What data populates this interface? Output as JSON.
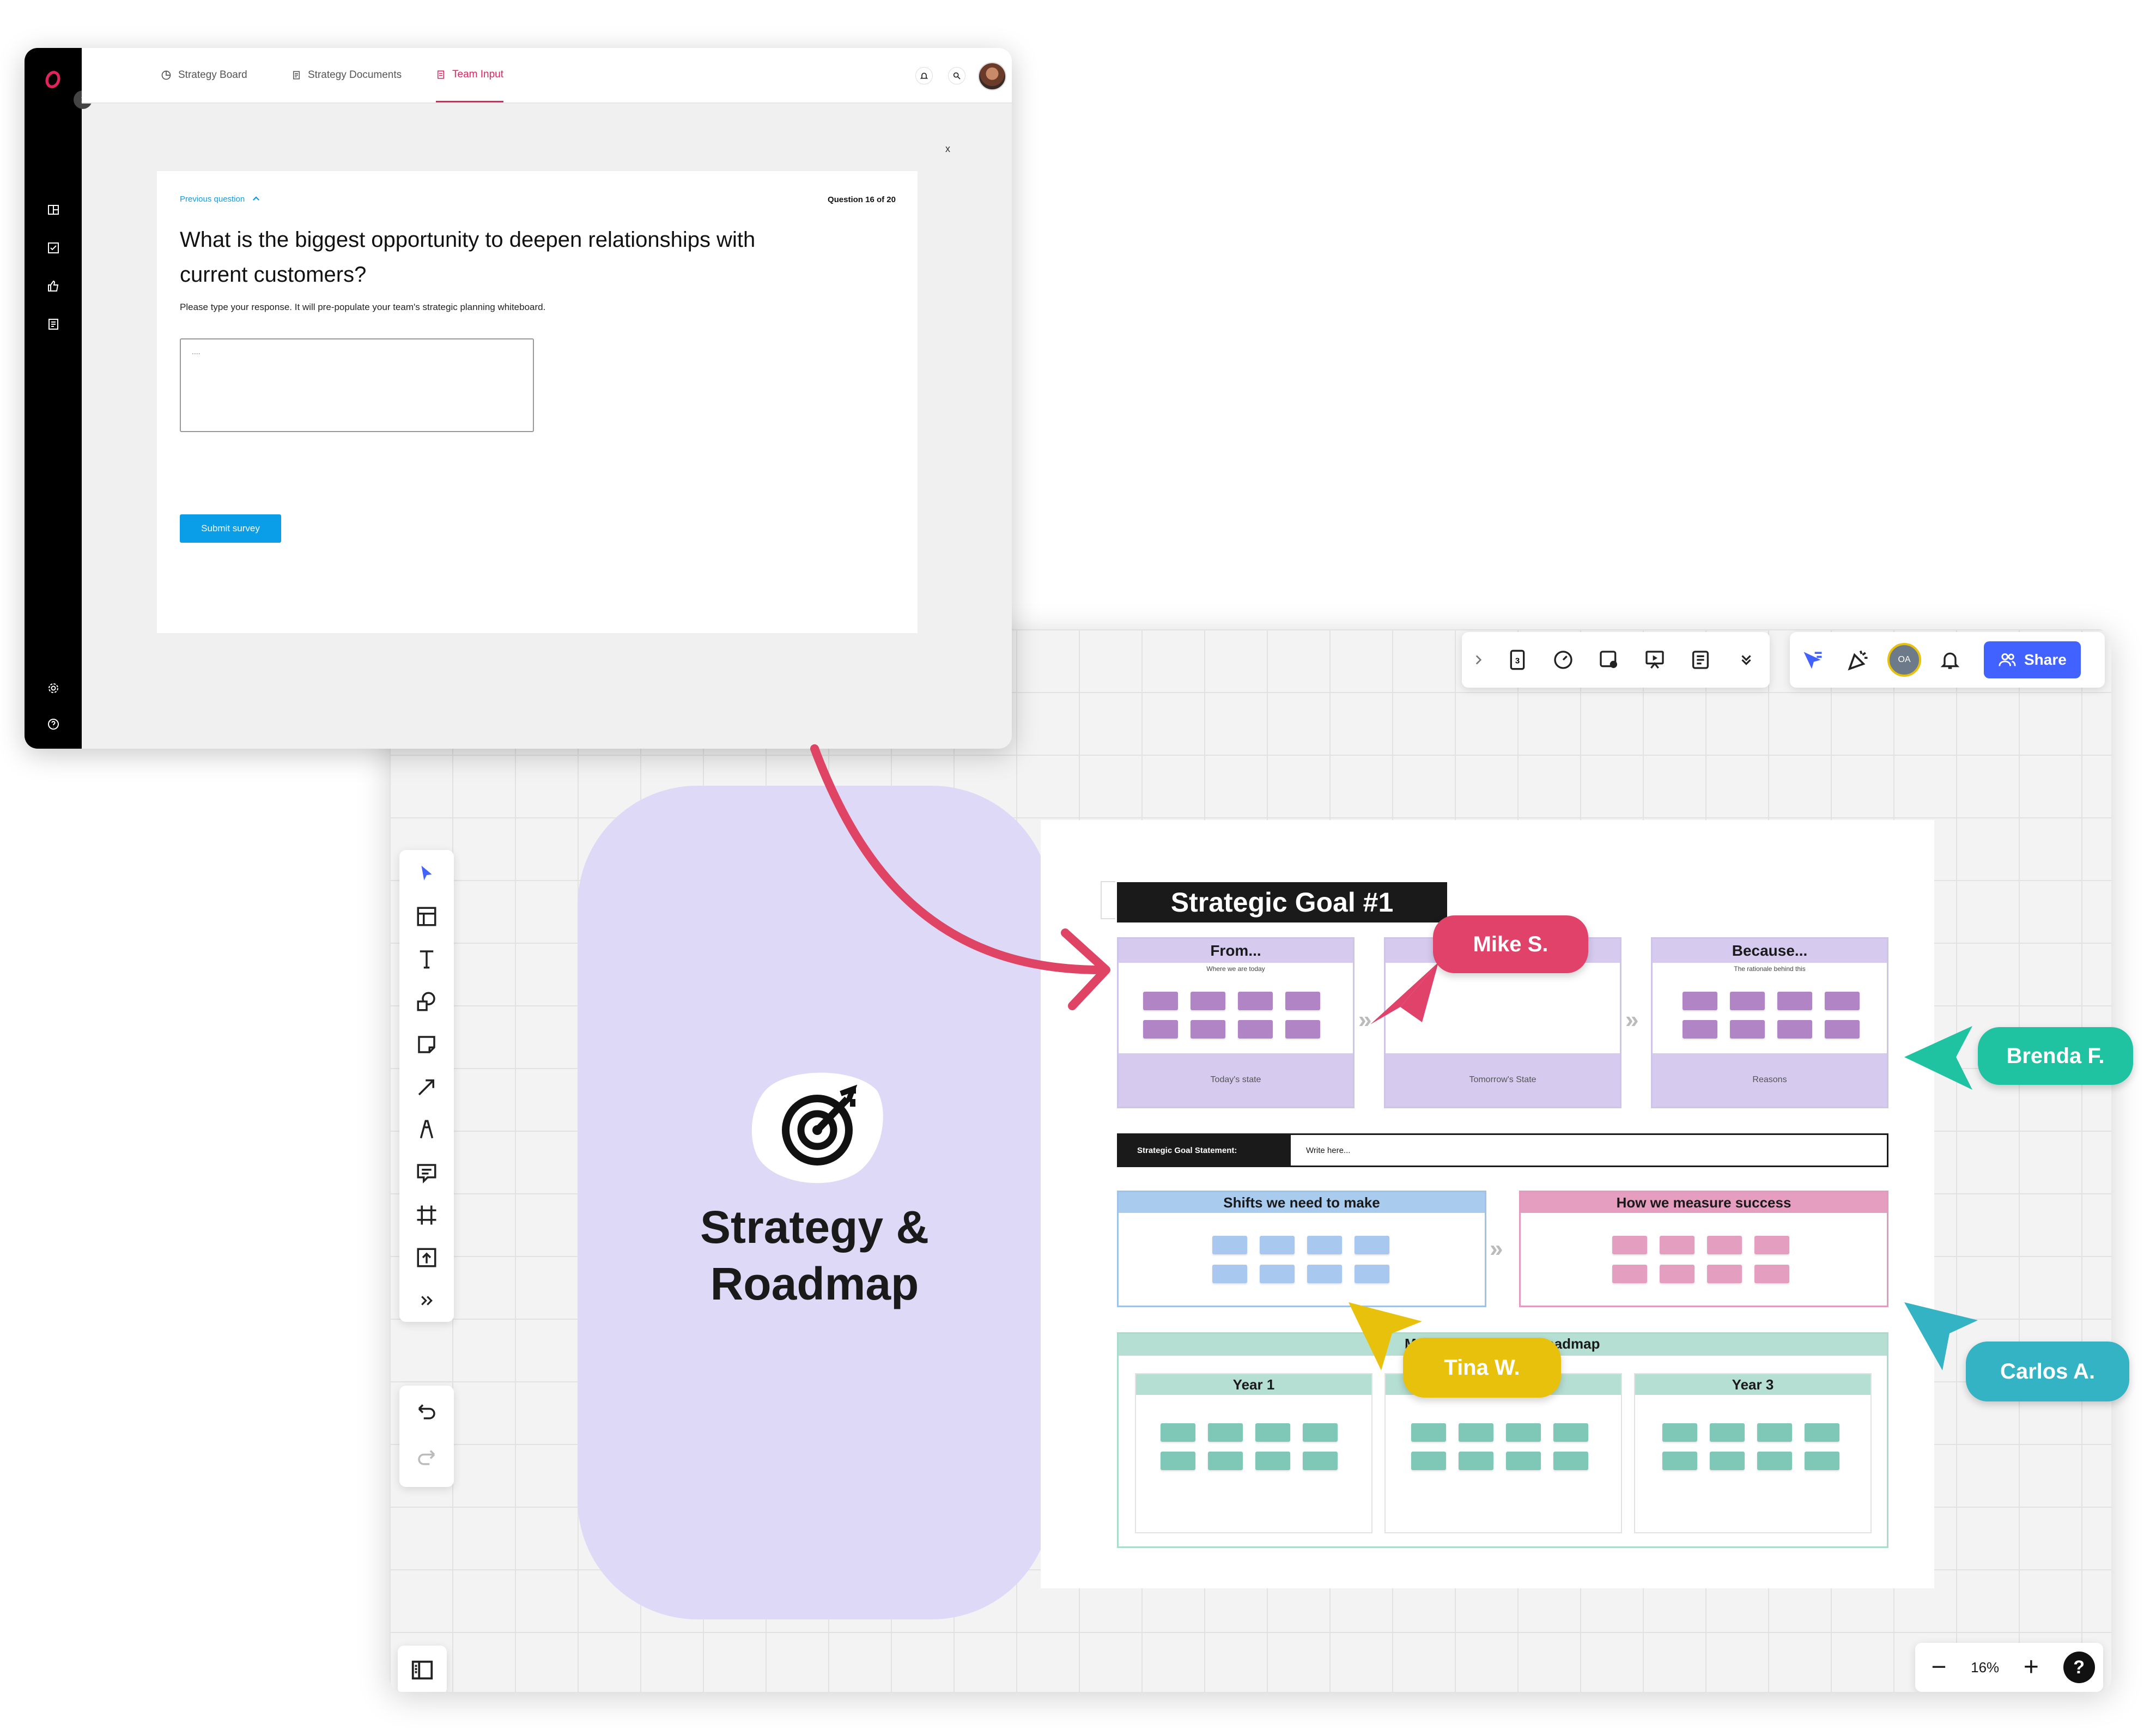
{
  "survey_app": {
    "tabs": [
      {
        "label": "Strategy Board",
        "icon": "pie-chart-icon",
        "active": false
      },
      {
        "label": "Strategy Documents",
        "icon": "document-icon",
        "active": false
      },
      {
        "label": "Team Input",
        "icon": "form-icon",
        "active": true
      }
    ],
    "accent_color": "#e0245e",
    "close_label": "x",
    "previous_question": "Previous question",
    "question_counter": "Question 16 of 20",
    "question_line1": "What is the biggest opportunity to deepen relationships with",
    "question_line2": "current customers?",
    "instructions": "Please type your response. It will pre-populate your team's strategic planning whiteboard.",
    "response_placeholder": "....",
    "submit_label": "Submit survey",
    "submit_color": "#0a9ee8"
  },
  "promo_card": {
    "title_line1": "Strategy &",
    "title_line2": "Roadmap",
    "icon": "target-icon",
    "background": "#ded9f6"
  },
  "whiteboard": {
    "share_label": "Share",
    "avatar_initials": "OA",
    "zoom_label": "16%",
    "help_label": "?",
    "board": {
      "title": "Strategic Goal #1",
      "columns": [
        {
          "header": "From...",
          "sub": "Where we are today",
          "footer": "Today's state"
        },
        {
          "header": "",
          "sub": "",
          "footer": "Tomorrow's State"
        },
        {
          "header": "Because...",
          "sub": "The rationale behind this",
          "footer": "Reasons"
        }
      ],
      "statement_label": "Strategic Goal Statement:",
      "statement_value": "Write here...",
      "shifts_title": "Shifts we need to make",
      "measure_title": "How we measure success",
      "roadmap_title": "Roadmap",
      "roadmap_title_prefix": "M",
      "years": [
        "Year 1",
        "",
        "Year 3"
      ]
    },
    "collaborators": [
      {
        "name": "Mike S.",
        "color": "#e0426a"
      },
      {
        "name": "Brenda F.",
        "color": "#1fc3a1"
      },
      {
        "name": "Carlos A.",
        "color": "#33b3c3"
      },
      {
        "name": "Tina W.",
        "color": "#e8c10c"
      }
    ]
  }
}
